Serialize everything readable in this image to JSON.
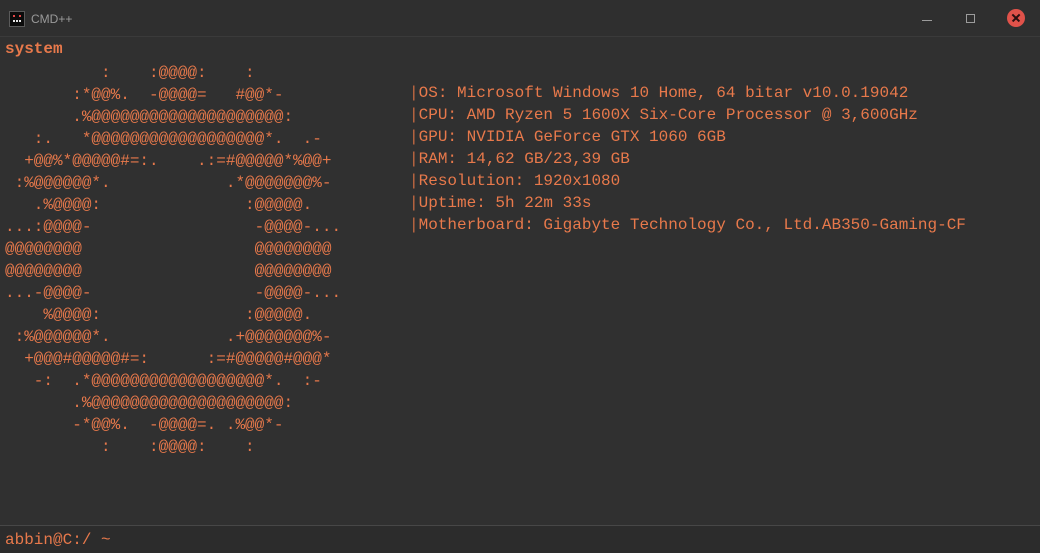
{
  "window": {
    "title": "CMD++"
  },
  "terminal": {
    "username": "system",
    "ascii_logo": [
      "          :    :@@@@:    :",
      "       :*@@%.  -@@@@=   #@@*-",
      "       .%@@@@@@@@@@@@@@@@@@@@:",
      "   :.   *@@@@@@@@@@@@@@@@@@*.  .-",
      "  +@@%*@@@@@#=:.    .:=#@@@@@*%@@+",
      " :%@@@@@@*.            .*@@@@@@@%-",
      "   .%@@@@:               :@@@@@.",
      "...:@@@@-                 -@@@@-...",
      "@@@@@@@@                  @@@@@@@@",
      "@@@@@@@@                  @@@@@@@@",
      "...-@@@@-                 -@@@@-...",
      "    %@@@@:               :@@@@@.",
      " :%@@@@@@*.            .+@@@@@@@%-",
      "  +@@@#@@@@@#=:      :=#@@@@@#@@@*",
      "   -:  .*@@@@@@@@@@@@@@@@@@*.  :-",
      "       .%@@@@@@@@@@@@@@@@@@@@:",
      "       -*@@%.  -@@@@=. .%@@*-",
      "          :    :@@@@:    :"
    ],
    "sysinfo": [
      "OS: Microsoft Windows 10 Home, 64 bitar v10.0.19042",
      "CPU: AMD Ryzen 5 1600X Six-Core Processor @ 3,600GHz",
      "GPU: NVIDIA GeForce GTX 1060 6GB",
      "RAM: 14,62 GB/23,39 GB",
      "Resolution: 1920x1080",
      "Uptime: 5h 22m 33s",
      "Motherboard: Gigabyte Technology Co., Ltd.AB350-Gaming-CF"
    ],
    "separator": "|"
  },
  "prompt": {
    "value": "abbin@C:/ ~"
  },
  "colors": {
    "background": "#303030",
    "accent": "#e8794b",
    "close_button": "#e0524a"
  }
}
